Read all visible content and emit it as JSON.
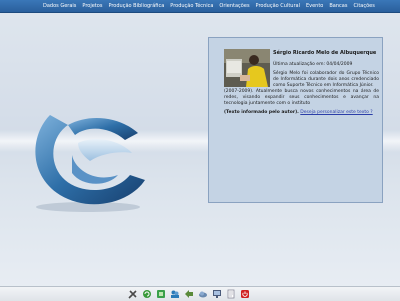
{
  "nav": {
    "items": [
      {
        "label": "Dados Gerais"
      },
      {
        "label": "Projetos"
      },
      {
        "label": "Produção Bibliográfica"
      },
      {
        "label": "Produção Técnica"
      },
      {
        "label": "Orientações"
      },
      {
        "label": "Produção Cultural"
      },
      {
        "label": "Evento"
      },
      {
        "label": "Bancas"
      },
      {
        "label": "Citações"
      }
    ]
  },
  "profile": {
    "name": "Sérgio Ricardo Melo de Albuquerque",
    "last_update": "Última atualização em: 04/04/2009",
    "bio_part1": "Sérgio Melo foi colaborador do Grupo Técnico de Informática durante dois anos credenciado como Suporte Técnico em Informática Júnior.",
    "bio_part2": "(2007-2009). Atualmente busca novos conhecimentos na área de redes, visando expandir seus conhecimentos e avançar na tecnologia juntamente com o instituto",
    "author_note": "(Texto informado pelo autor).",
    "personalize_link": "Deseja personalizar este texto ?"
  },
  "taskbar": {
    "icons": [
      {
        "name": "tools-icon",
        "color": "#4a4a4a"
      },
      {
        "name": "refresh-icon",
        "color": "#3a9a3a"
      },
      {
        "name": "network-icon",
        "color": "#3aa04a"
      },
      {
        "name": "users-icon",
        "color": "#2a7ab8"
      },
      {
        "name": "back-icon",
        "color": "#5a8a3a"
      },
      {
        "name": "cloud-icon",
        "color": "#6a8ab0"
      },
      {
        "name": "monitor-icon",
        "color": "#4a5a7a"
      },
      {
        "name": "document-icon",
        "color": "#8a8a9a"
      },
      {
        "name": "power-icon",
        "color": "#d02020"
      }
    ]
  },
  "colors": {
    "topbar": "#2a5f9c",
    "panel": "#c4d3e4",
    "logo": "#2e6fa8"
  }
}
